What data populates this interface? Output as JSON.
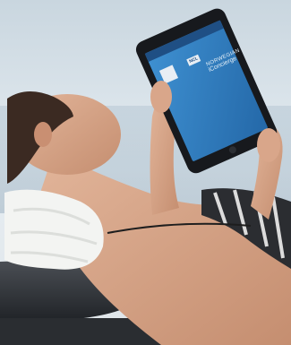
{
  "tablet": {
    "header_label": "NCL",
    "app_title_line1": "NORWEGIAN",
    "app_title_line2": "iConcierge"
  },
  "colors": {
    "sky": "#e4ecf2",
    "sea": "#a9bfcf",
    "skin": "#d9a78c",
    "hair": "#3d2b22",
    "towel": "#f2f3f1",
    "lounger": "#2c2f33",
    "tablet_frame": "#1a1c20",
    "screen": "#2f7fc3"
  }
}
